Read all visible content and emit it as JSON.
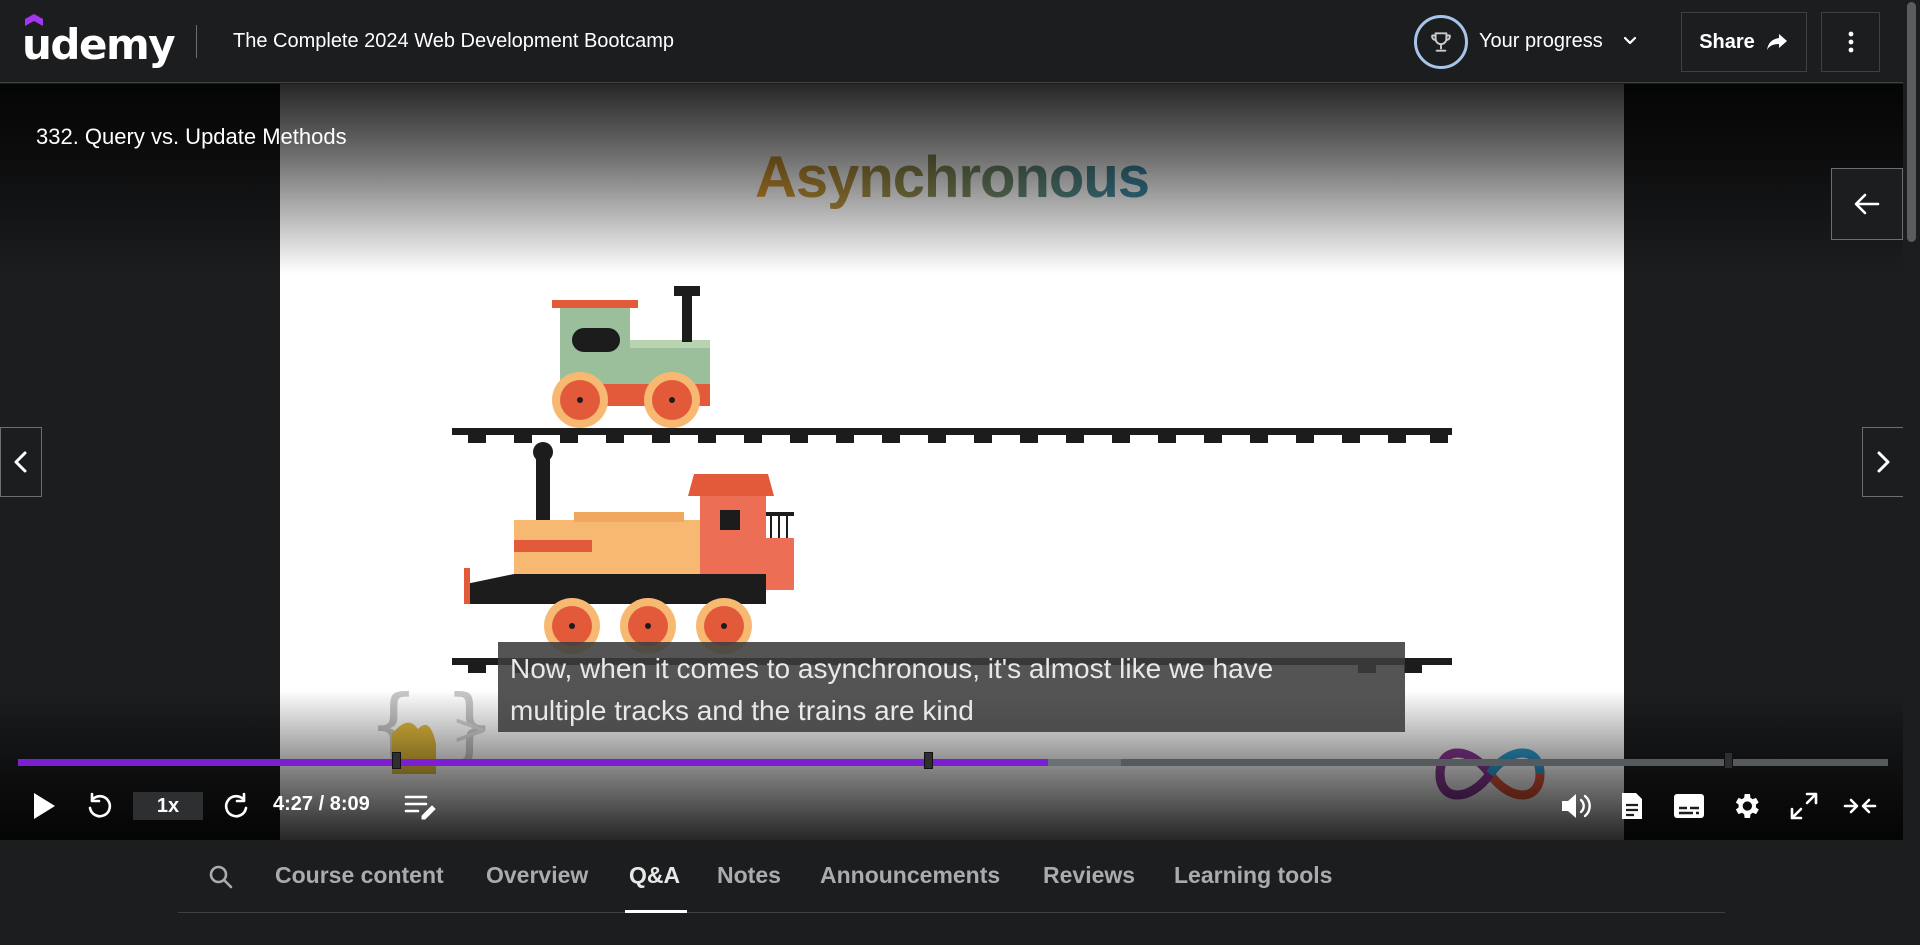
{
  "header": {
    "logo": "udemy",
    "course_title": "The Complete 2024 Web Development Bootcamp",
    "progress_label": "Your progress",
    "share_label": "Share"
  },
  "video": {
    "lecture_title": "332. Query vs. Update Methods",
    "slide_title": "Asynchronous",
    "caption_line_1": "Now, when it comes to asynchronous, it's almost like we have",
    "caption_line_2": "multiple tracks and the trains are kind",
    "playback_rate": "1x",
    "time": "4:27 / 8:09",
    "progress_fraction": 0.551,
    "buffered_fraction": 0.59
  },
  "tabs": [
    {
      "label": "Course content",
      "active": false
    },
    {
      "label": "Overview",
      "active": false
    },
    {
      "label": "Q&A",
      "active": true
    },
    {
      "label": "Notes",
      "active": false
    },
    {
      "label": "Announcements",
      "active": false
    },
    {
      "label": "Reviews",
      "active": false
    },
    {
      "label": "Learning tools",
      "active": false
    }
  ],
  "colors": {
    "background": "#1c1d1f",
    "accent": "#7c1fd3",
    "logo_hat": "#a435f0"
  }
}
